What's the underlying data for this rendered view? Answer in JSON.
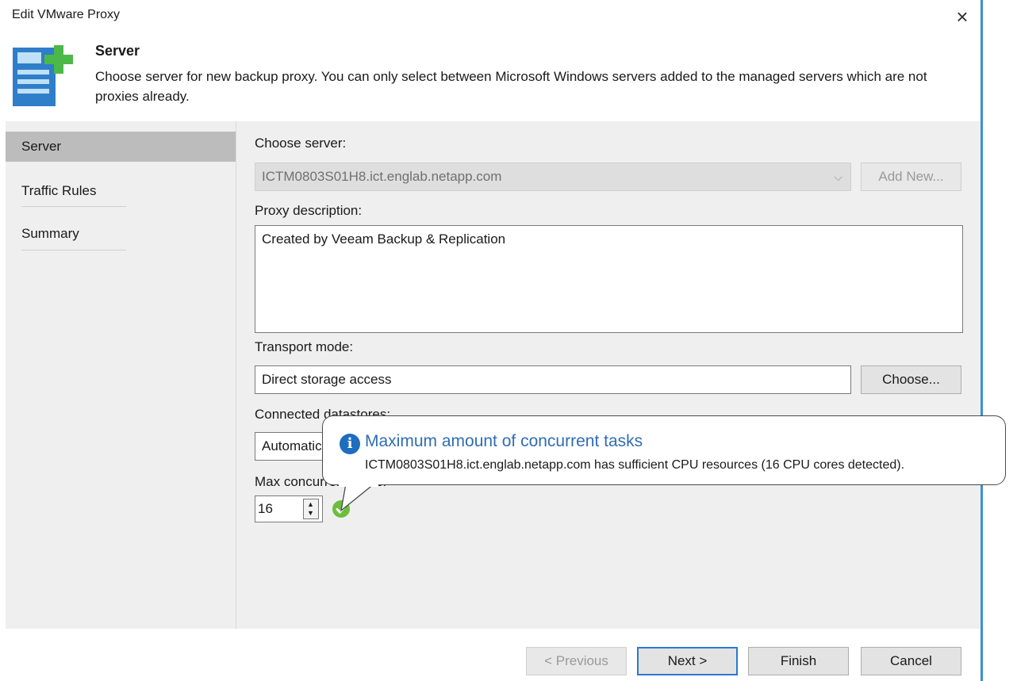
{
  "window": {
    "title": "Edit VMware Proxy",
    "close_glyph": "×"
  },
  "header": {
    "title": "Server",
    "description": "Choose server for new backup proxy. You can only select between Microsoft Windows servers added to the managed servers which are not proxies already.",
    "icon": "proxy-add-icon"
  },
  "nav": {
    "items": [
      {
        "label": "Server",
        "selected": true
      },
      {
        "label": "Traffic Rules",
        "selected": false
      },
      {
        "label": "Summary",
        "selected": false
      }
    ]
  },
  "form": {
    "choose_server_label": "Choose server:",
    "server_value": "ICTM0803S01H8.ict.englab.netapp.com",
    "add_new_label": "Add New...",
    "proxy_description_label": "Proxy description:",
    "proxy_description_value": "Created by Veeam Backup & Replication",
    "transport_mode_label": "Transport mode:",
    "transport_mode_value": "Direct storage access",
    "choose_button": "Choose...",
    "connected_datastores_label": "Connected datastores:",
    "connected_datastores_value": "Automatic detection (recommended)",
    "max_concurrent_label": "Max concurrent tasks:",
    "max_concurrent_value": "16"
  },
  "tooltip": {
    "title": "Maximum amount of concurrent tasks",
    "text": "ICTM0803S01H8.ict.englab.netapp.com has sufficient CPU resources (16 CPU cores detected)."
  },
  "footer": {
    "previous": "< Previous",
    "next": "Next >",
    "finish": "Finish",
    "cancel": "Cancel"
  },
  "colors": {
    "accent": "#2b78d0",
    "success": "#6bbf3b",
    "info": "#1e6dbf"
  }
}
